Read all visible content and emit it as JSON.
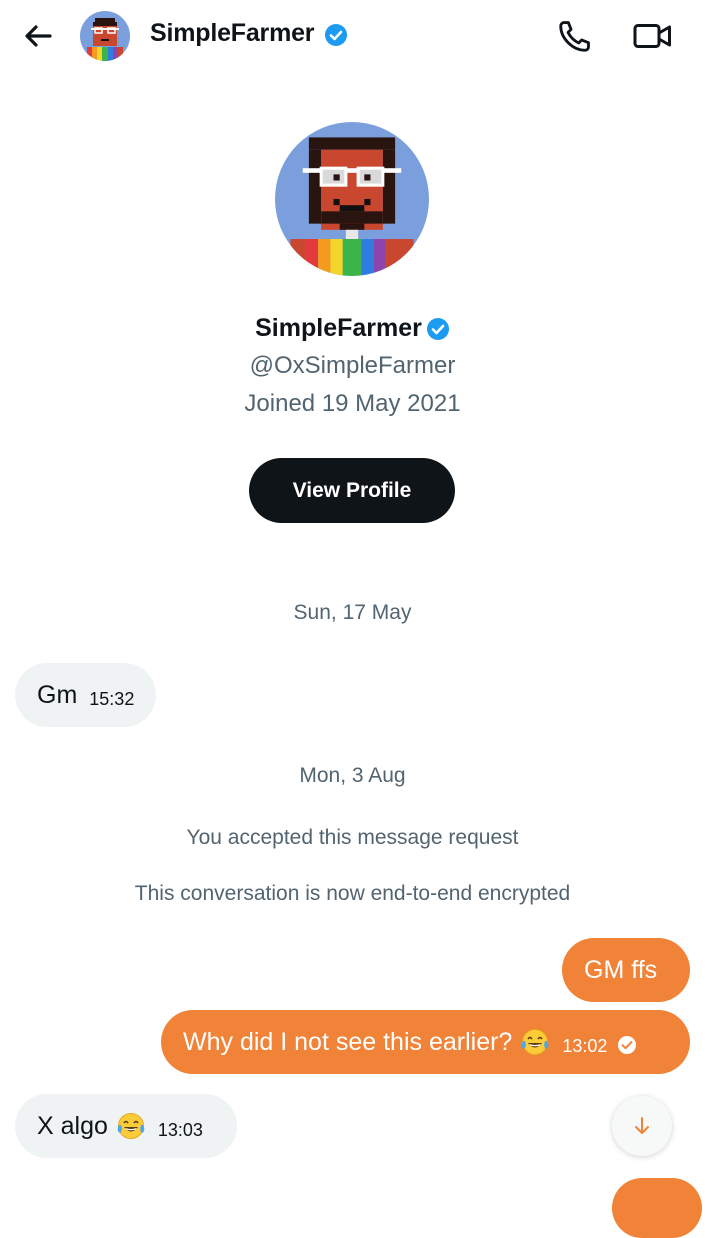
{
  "header": {
    "name": "SimpleFarmer",
    "back_icon": "arrow-left-icon",
    "call_icon": "phone-icon",
    "video_icon": "video-camera-icon",
    "verified_icon": "verified-badge-icon"
  },
  "profile": {
    "name": "SimpleFarmer",
    "handle": "@OxSimpleFarmer",
    "joined": "Joined 19 May 2021",
    "view_profile_label": "View Profile"
  },
  "conversation": {
    "date_1": "Sun, 17 May",
    "msg_1": {
      "text": "Gm",
      "time": "15:32",
      "direction": "incoming"
    },
    "date_2": "Mon, 3 Aug",
    "system_1": "You accepted this message request",
    "system_2": "This conversation is now end-to-end encrypted",
    "msg_2": {
      "text": "GM ffs",
      "direction": "outgoing"
    },
    "msg_3": {
      "text": "Why did I not see this earlier?",
      "emoji": "😂",
      "time": "13:02",
      "direction": "outgoing",
      "status_icon": "read-check-icon"
    },
    "msg_4": {
      "text": "X algo",
      "emoji": "😂",
      "time": "13:03",
      "direction": "incoming"
    }
  },
  "scroll_down_icon": "arrow-down-icon",
  "colors": {
    "accent_outgoing": "#f08337",
    "incoming_bubble": "#eff3f4",
    "verified_blue": "#1d9bf0",
    "text_primary": "#0f1419",
    "text_secondary": "#536471"
  }
}
